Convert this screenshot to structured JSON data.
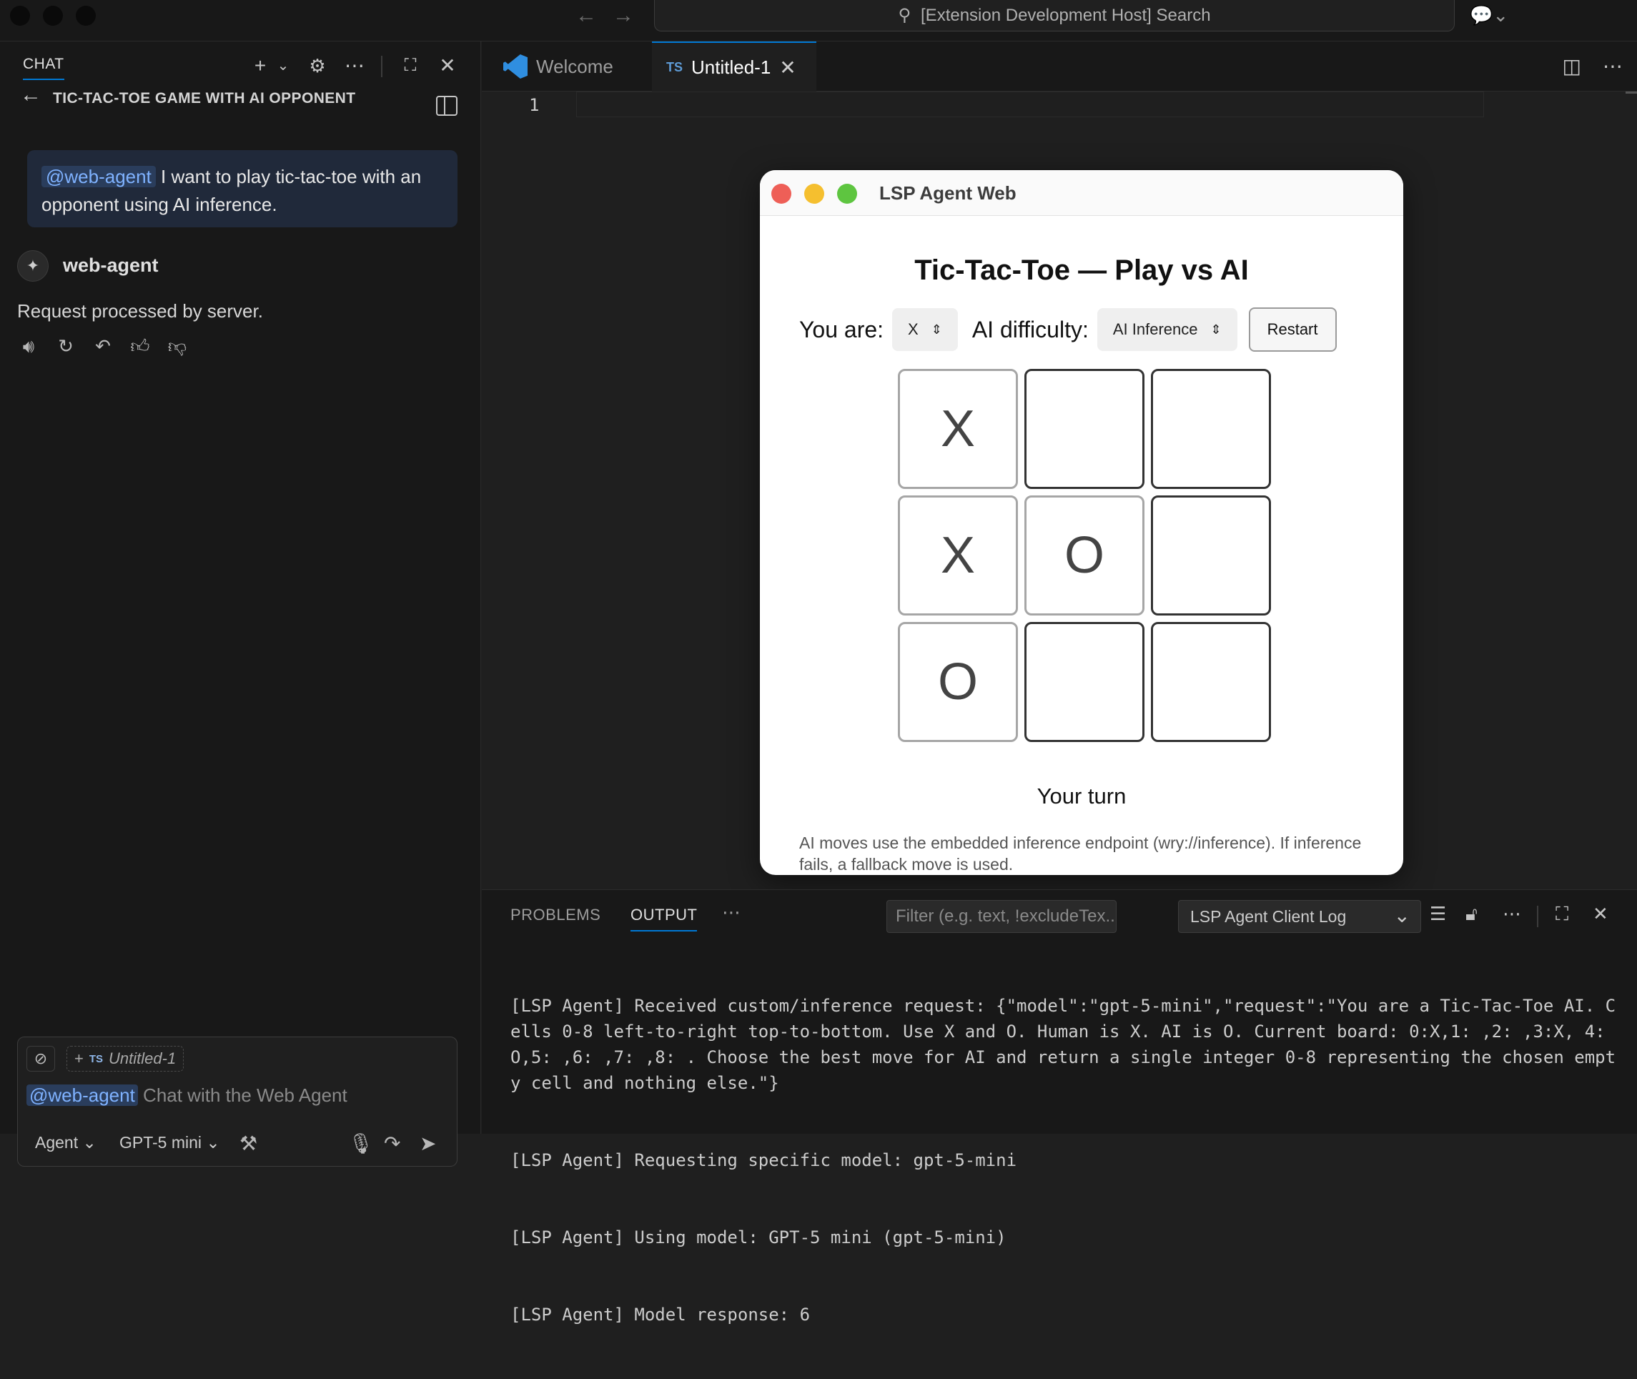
{
  "titlebar": {
    "search_text": "[Extension Development Host] Search"
  },
  "chat": {
    "tab_label": "CHAT",
    "conversation_title": "TIC-TAC-TOE GAME WITH AI OPPONENT",
    "user_message": {
      "mention": "@web-agent",
      "text": " I want to play tic-tac-toe with an opponent using AI inference."
    },
    "agent_name": "web-agent",
    "agent_reply": "Request processed by server.",
    "input": {
      "context_chip": "Untitled-1",
      "context_badge": "TS",
      "mention": "@web-agent",
      "placeholder": " Chat with the Web Agent",
      "mode": "Agent",
      "model": "GPT-5 mini"
    }
  },
  "editor": {
    "tabs": [
      {
        "label": "Welcome",
        "active": false
      },
      {
        "label": "Untitled-1",
        "badge": "TS",
        "active": true
      }
    ],
    "line_number": "1"
  },
  "lsp_window": {
    "title": "LSP Agent Web",
    "heading": "Tic-Tac-Toe — Play vs AI",
    "you_are_label": "You are:",
    "you_are_value": "X",
    "difficulty_label": "AI difficulty:",
    "difficulty_value": "AI Inference",
    "restart_label": "Restart",
    "board": [
      "X",
      "",
      "",
      "X",
      "O",
      "",
      "O",
      "",
      ""
    ],
    "status": "Your turn",
    "note": "AI moves use the embedded inference endpoint (wry://inference). If inference fails, a fallback move is used."
  },
  "panel": {
    "tabs": [
      "PROBLEMS",
      "OUTPUT"
    ],
    "active_tab": "OUTPUT",
    "filter_placeholder": "Filter (e.g. text, !excludeTex...",
    "log_source": "LSP Agent Client Log",
    "log_lines": [
      "[LSP Agent] Received custom/inference request: {\"model\":\"gpt-5-mini\",\"request\":\"You are a Tic-Tac-Toe AI. Cells 0-8 left-to-right top-to-bottom. Use X and O. Human is X. AI is O. Current board: 0:X,1: ,2: ,3:X, 4:O,5: ,6: ,7: ,8: . Choose the best move for AI and return a single integer 0-8 representing the chosen empty cell and nothing else.\"}",
      "[LSP Agent] Requesting specific model: gpt-5-mini",
      "[LSP Agent] Using model: GPT-5 mini (gpt-5-mini)",
      "[LSP Agent] Model response: 6"
    ]
  },
  "colors": {
    "accent": "#0078d4",
    "mac_red": "#ee5f57",
    "mac_yellow": "#f5bf2f",
    "mac_green": "#5ec540"
  }
}
